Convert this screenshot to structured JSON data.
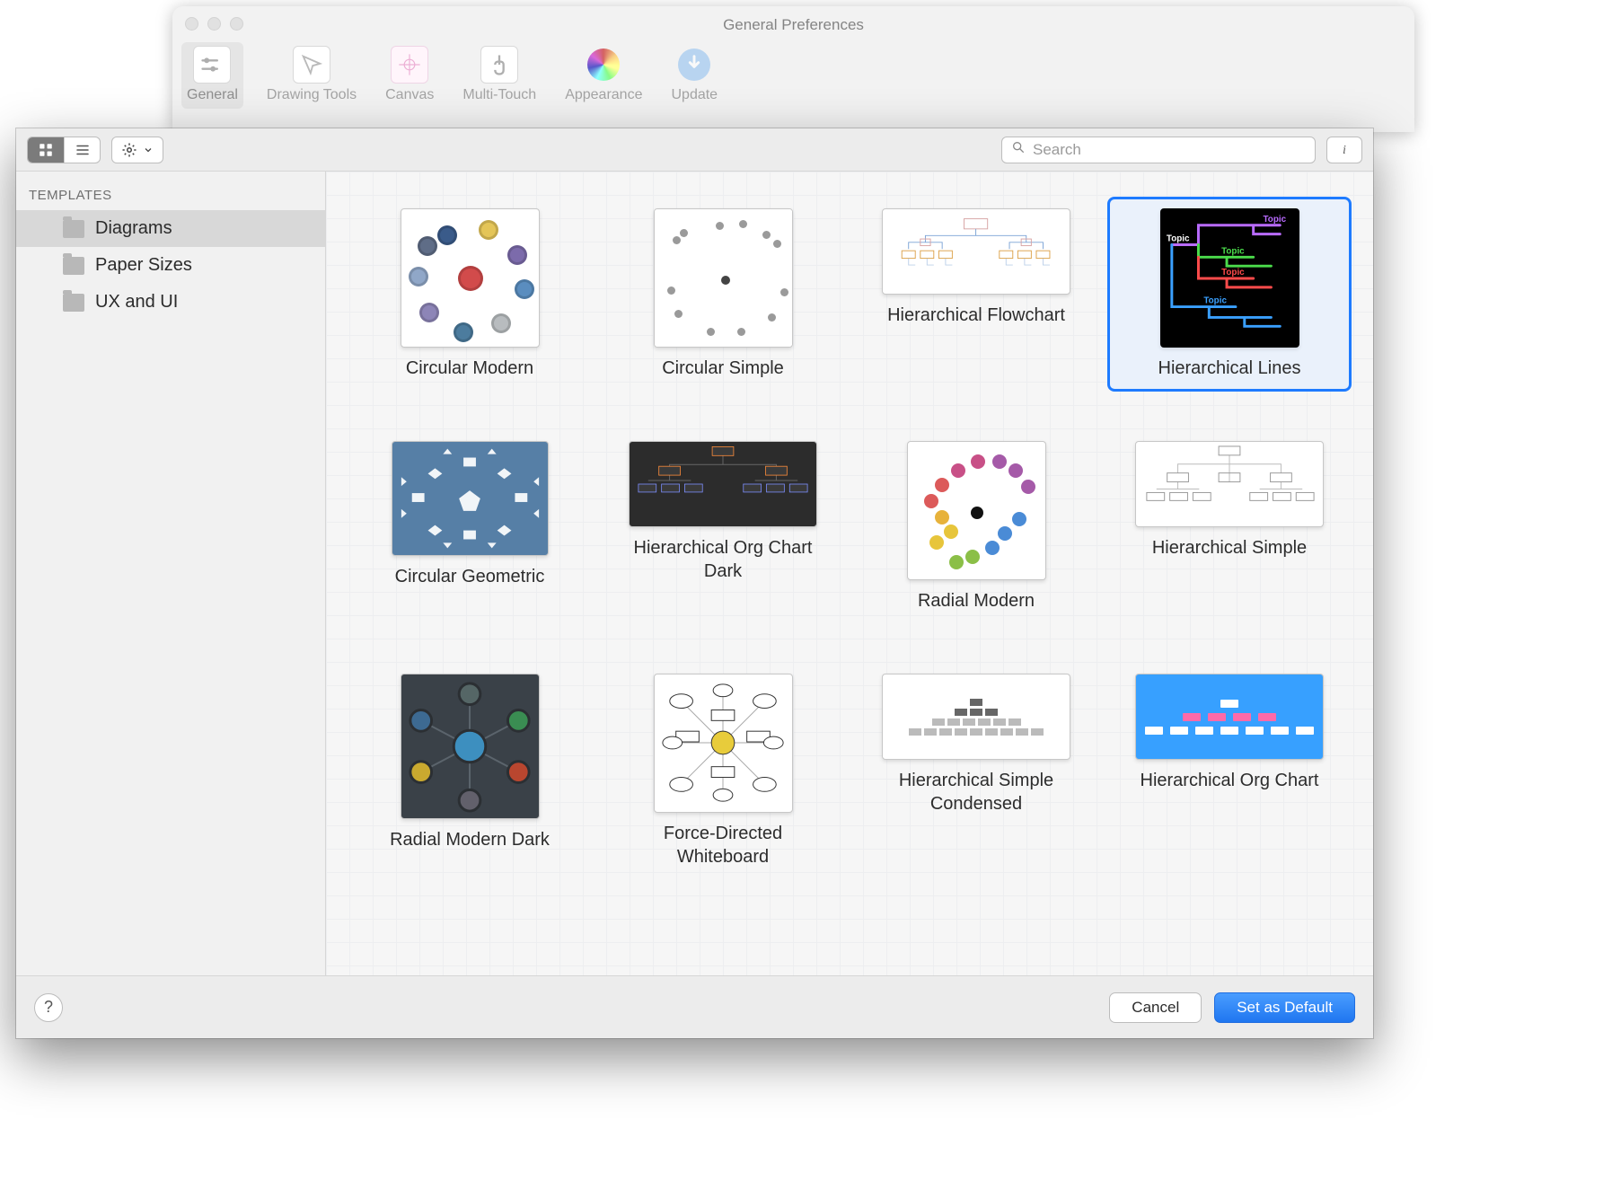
{
  "parent": {
    "title": "General Preferences",
    "tools": [
      {
        "label": "General",
        "active": true
      },
      {
        "label": "Drawing Tools"
      },
      {
        "label": "Canvas"
      },
      {
        "label": "Multi-Touch"
      },
      {
        "label": "Appearance"
      },
      {
        "label": "Update"
      }
    ]
  },
  "sheet": {
    "search_placeholder": "Search",
    "sidebar": {
      "header": "TEMPLATES",
      "items": [
        {
          "label": "Diagrams",
          "selected": true
        },
        {
          "label": "Paper Sizes"
        },
        {
          "label": "UX and UI"
        }
      ]
    },
    "templates": [
      {
        "label": "Circular Modern",
        "kind": "cm",
        "shape": "square"
      },
      {
        "label": "Circular Simple",
        "kind": "cs",
        "shape": "square"
      },
      {
        "label": "Hierarchical Flowchart",
        "kind": "hf",
        "shape": "wide"
      },
      {
        "label": "Hierarchical Lines",
        "kind": "hl",
        "shape": "square",
        "selected": true
      },
      {
        "label": "Circular Geometric",
        "kind": "cg",
        "shape": "mid"
      },
      {
        "label": "Hierarchical Org Chart Dark",
        "kind": "hod",
        "shape": "wide"
      },
      {
        "label": "Radial Modern",
        "kind": "rm",
        "shape": "square"
      },
      {
        "label": "Hierarchical Simple",
        "kind": "hs",
        "shape": "wide"
      },
      {
        "label": "Radial Modern Dark",
        "kind": "rmd",
        "shape": "tall"
      },
      {
        "label": "Force-Directed Whiteboard",
        "kind": "fdw",
        "shape": "square"
      },
      {
        "label": "Hierarchical Simple Condensed",
        "kind": "hsc",
        "shape": "wide"
      },
      {
        "label": "Hierarchical Org Chart",
        "kind": "hoc",
        "shape": "wide"
      }
    ],
    "footer": {
      "cancel": "Cancel",
      "default": "Set as Default"
    }
  }
}
